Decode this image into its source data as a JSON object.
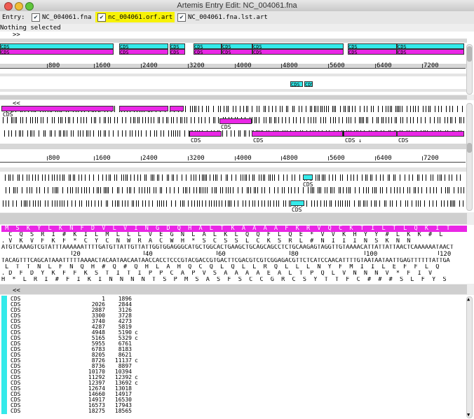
{
  "window": {
    "title": "Artemis Entry Edit: NC_004061.fna"
  },
  "entry_bar": {
    "label": "Entry:",
    "entries": [
      {
        "name": "NC_004061.fna",
        "checked": true,
        "highlight": false
      },
      {
        "name": "nc_004061.orf.art",
        "checked": true,
        "highlight": true
      },
      {
        "name": "NC_004061.fna.lst.art",
        "checked": true,
        "highlight": false
      }
    ]
  },
  "status": {
    "text": "Nothing selected"
  },
  "overview": {
    "nav": ">>",
    "ticks": [
      "800",
      "1600",
      "2400",
      "3200",
      "4000",
      "4800",
      "5600",
      "6400",
      "7200"
    ],
    "cds_label": "CDS",
    "cds_suffix_label": "CDS ↓"
  },
  "detail": {
    "nav": "<<",
    "ticks": [
      "800",
      "1600",
      "2400",
      "3200",
      "4000",
      "4800",
      "5600",
      "6400",
      "7200"
    ]
  },
  "sequence": {
    "ticks": [
      "20",
      "40",
      "60",
      "80",
      "100",
      "120"
    ],
    "aa_top": " M  S  K  Y  L  K  N  F  D  V  L  V  I  N  G  D  Q  H  A  L  T  K  A  A  A  A  F  K  R  V  Q  C  K  T  I  L  T  L  Q  K  I  T  ",
    "frame2": "  C  Q  S  R  I  #  K  I  L  M  L  L  L  V  E  G  N  L  A  L  K  L  Q  Q  F  L  Q  E  *  V  V  K  H  Y  Y  #  L  K  K  #  L",
    "frame3": ". V  K  V  F  K  F  *  C  Y  C  N  W  R  A  C  W  H  *  S  C  S  S  L  C  K  S  R  L  #  N  I  I  I  N  S  K  N  N",
    "forward": "ATGTCAAAGTCGTATTTAAAAAATTTTGATGTTATTGTTATTGGTGGAGGGCATGCTGGCACTGAAGCTGCAGCAGCCTCTGCAAGAGTAGGTTGTAAAACATTATTATTAACTCAAAAAATAACT",
    "reverse": "TACAGTTTCAGCATAAATTTTTAAAACTACAATAACAATAACCACCTCCCGTACGACCGTGACTTCGACGTCGTCGGAGACGTTCTCATCCAACATTTTGTAATAATAATTGAGTTTTTTATTGA",
    "rframe1": " L  T  T  N  L  F  N  Q  H  #  Q  #  Q  H  L  A  H  Q  C  Q  L  Q  L  L  R  Q  L  L  L  N  Y  F  M  I  I  L  E  F  F  L  Q",
    "rframe2": ". D  F  D  Y  K  F  F  K  S  T  I  T  I  P  P  C  A  P  V  S  A  A  A  A  E  A  L  T  P  Q  L  V  N  N  N  V  *  F  I  V",
    "rframe3": "H  *  L  R  I  #  F  I  K  I  N  N  N  N  T  S  P  M  S  A  S  F  S  C  C  G  R  C  S  Y  T  T  F  C  #  #  #  S  L  F  Y  S"
  },
  "list": {
    "nav": "<<",
    "rows": [
      {
        "key": "CDS",
        "start": "1",
        "end": "1896",
        "comp": ""
      },
      {
        "key": "CDS",
        "start": "2026",
        "end": "2844",
        "comp": ""
      },
      {
        "key": "CDS",
        "start": "2887",
        "end": "3126",
        "comp": ""
      },
      {
        "key": "CDS",
        "start": "3300",
        "end": "3728",
        "comp": ""
      },
      {
        "key": "CDS",
        "start": "3740",
        "end": "4273",
        "comp": ""
      },
      {
        "key": "CDS",
        "start": "4287",
        "end": "5819",
        "comp": ""
      },
      {
        "key": "CDS",
        "start": "4948",
        "end": "5190",
        "comp": "c"
      },
      {
        "key": "CDS",
        "start": "5165",
        "end": "5329",
        "comp": "c"
      },
      {
        "key": "CDS",
        "start": "5955",
        "end": "6761",
        "comp": ""
      },
      {
        "key": "CDS",
        "start": "6783",
        "end": "8183",
        "comp": ""
      },
      {
        "key": "CDS",
        "start": "8205",
        "end": "8621",
        "comp": ""
      },
      {
        "key": "CDS",
        "start": "8726",
        "end": "11137",
        "comp": "c"
      },
      {
        "key": "CDS",
        "start": "8736",
        "end": "8897",
        "comp": ""
      },
      {
        "key": "CDS",
        "start": "10170",
        "end": "10394",
        "comp": ""
      },
      {
        "key": "CDS",
        "start": "11292",
        "end": "12392",
        "comp": "c"
      },
      {
        "key": "CDS",
        "start": "12397",
        "end": "13692",
        "comp": "c"
      },
      {
        "key": "CDS",
        "start": "12674",
        "end": "13018",
        "comp": ""
      },
      {
        "key": "CDS",
        "start": "14660",
        "end": "14917",
        "comp": ""
      },
      {
        "key": "CDS",
        "start": "14917",
        "end": "16530",
        "comp": ""
      },
      {
        "key": "CDS",
        "start": "16573",
        "end": "17943",
        "comp": ""
      },
      {
        "key": "CDS",
        "start": "18275",
        "end": "18565",
        "comp": ""
      }
    ]
  },
  "colors": {
    "cds_cyan": "#33eaea",
    "cds_magenta": "#ea27e6",
    "highlight_yellow": "#f7f205"
  }
}
